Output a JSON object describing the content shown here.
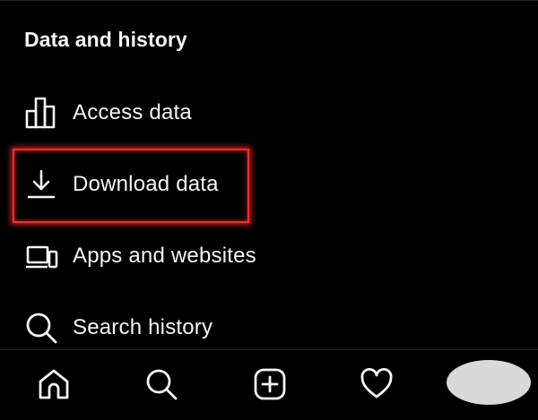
{
  "section": {
    "title": "Data and history"
  },
  "items": [
    {
      "label": "Access data",
      "icon": "bar-chart-icon"
    },
    {
      "label": "Download data",
      "icon": "download-icon"
    },
    {
      "label": "Apps and websites",
      "icon": "devices-icon"
    },
    {
      "label": "Search history",
      "icon": "search-icon"
    }
  ],
  "highlight_color": "#ff2a2a",
  "bottom_nav": {
    "items": [
      "home-icon",
      "search-icon",
      "create-icon",
      "heart-icon",
      "profile-avatar"
    ]
  }
}
